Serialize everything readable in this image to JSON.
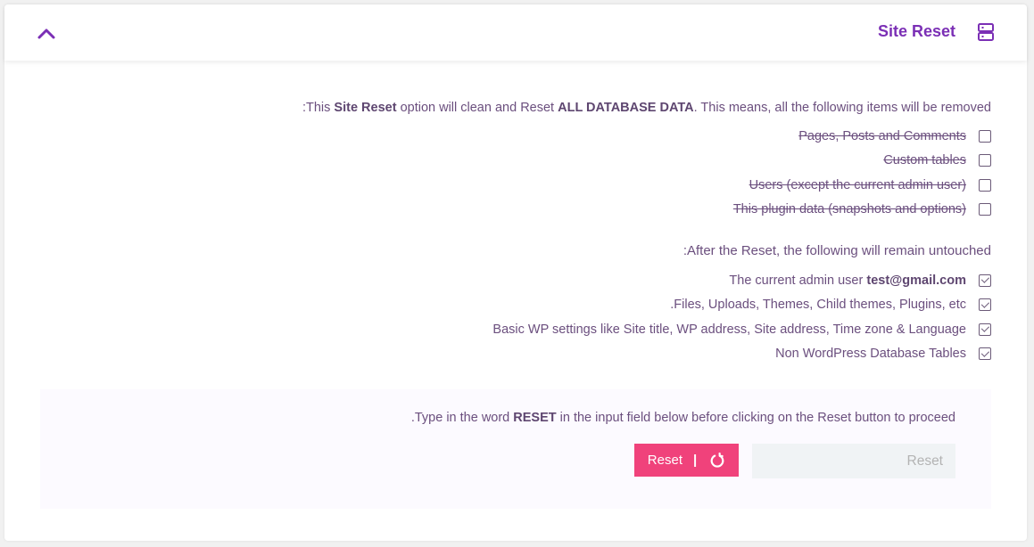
{
  "header": {
    "title": "Site Reset",
    "collapse_icon": "chevron-up-icon",
    "title_icon": "server-icon",
    "accent_color": "#7b2fb5"
  },
  "intro": {
    "prefix": ":This ",
    "site_reset": "Site Reset",
    "middle": " option will clean and Reset ",
    "all_data": "ALL DATABASE DATA",
    "suffix": ". This means, all the following items will be removed"
  },
  "removed_items": [
    {
      "label": "Pages, Posts and Comments",
      "checked": false
    },
    {
      "label": "Custom tables",
      "checked": false
    },
    {
      "label": "Users (except the current admin user)",
      "checked": false
    },
    {
      "label": "This plugin data (snapshots and options)",
      "checked": false
    }
  ],
  "untouched_heading": ":After the Reset, the following will remain untouched",
  "untouched_items": {
    "admin_prefix": "The current admin user ",
    "admin_email": "test@gmail.com",
    "files": ".Files, Uploads, Themes, Child themes, Plugins, etc",
    "settings": "Basic WP settings like Site title, WP address, Site address, Time zone & Language",
    "tables": "Non WordPress Database Tables"
  },
  "confirm": {
    "prefix": ".Type in the word ",
    "word": "RESET",
    "suffix": " in the input field below before clicking on the Reset button to proceed",
    "button_label": "Reset",
    "button_separator": "|",
    "button_icon": "refresh-icon",
    "button_color": "#f0427b",
    "input_placeholder": "Reset",
    "input_value": ""
  }
}
